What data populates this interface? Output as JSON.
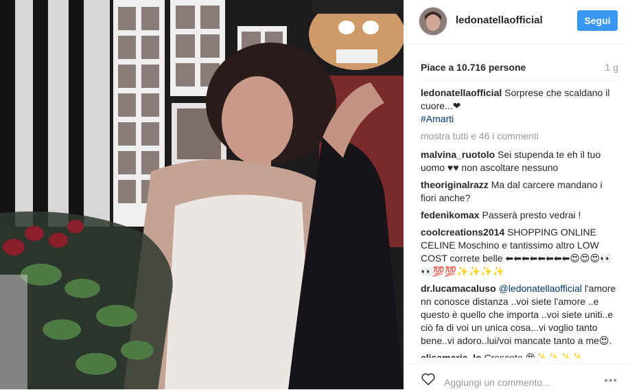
{
  "header": {
    "username": "ledonatellaofficial",
    "follow_label": "Segui"
  },
  "post": {
    "likes": "Piace a 10.716 persone",
    "time": "1 g"
  },
  "caption": {
    "user": "ledonatellaofficial",
    "text": "Sorprese che scaldano il cuore...❤",
    "hashtag": "#Amarti"
  },
  "show_all": "mostra tutti e 46 i commenti",
  "comments": [
    {
      "user": "malvina_ruotolo",
      "text": "Sei stupenda te eh il tuo uomo ♥♥ non ascoltare nessuno"
    },
    {
      "user": "theoriginalrazz",
      "text": "Ma dal carcere mandano i fiori anche?"
    },
    {
      "user": "fedenikomax",
      "text": "Passerà presto vedrai !"
    },
    {
      "user": "coolcreations2014",
      "text": "SHOPPING ONLINE CELINE Moschino e tantissimo altro LOW COST correte belle ⬅⬅⬅⬅⬅⬅⬅⬅😍😍😍👀👀💯💯✨✨✨✨"
    },
    {
      "user": "dr.lucamacaluso",
      "mention": "@ledonatellaofficial",
      "text": "l'amore nn conosce distanza ..voi siete l'amore ..e questo è quello che importa ..voi siete uniti..e ciò fa di voi un unica cosa...vi voglio tanto bene..vi adoro..lui/voi mancate tanto a me😍."
    },
    {
      "user": "elisamaria_lo",
      "text": "Crescete 😍✨✨✨✨"
    }
  ],
  "comment_input": {
    "placeholder": "Aggiungi un commento..."
  },
  "colors": {
    "accent": "#3897f0",
    "hashtag": "#003569",
    "muted": "#999999",
    "photo_bg": "#1d1b1d"
  },
  "icons": {
    "like": "heart-outline-icon",
    "options": "more-options-icon"
  }
}
